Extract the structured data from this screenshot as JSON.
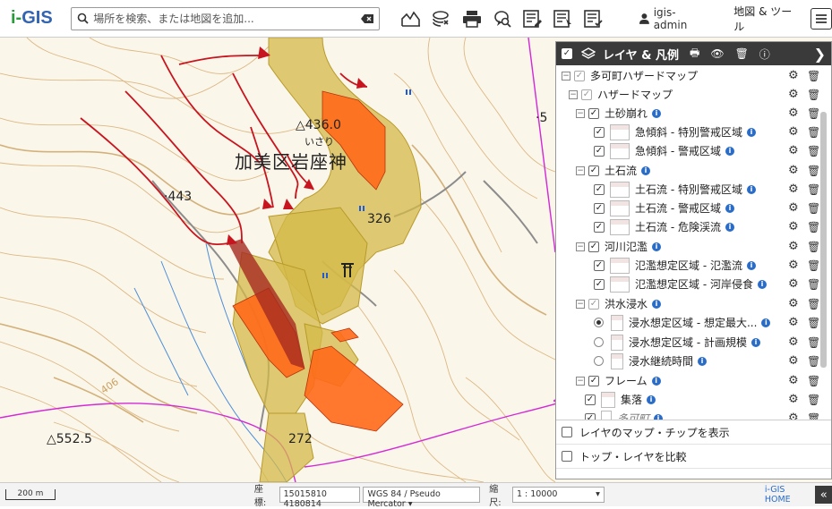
{
  "app": {
    "logo_i": "i-",
    "logo_gis": "GIS",
    "brand_colors": {
      "i": "#2a9a3a",
      "gis": "#3264b0"
    }
  },
  "search": {
    "placeholder": "場所を検索、または地図を追加..."
  },
  "toolbar": {
    "icons": [
      "elevation-profile-icon",
      "layers-stack-icon",
      "print-icon",
      "location-search-icon",
      "list-edit-icon",
      "list-select-icon",
      "list-check-icon"
    ]
  },
  "user": {
    "name": "igis-admin"
  },
  "map_tool_label": "地図 & ツール",
  "map": {
    "labels": {
      "peak_436": "△436.0",
      "isari": "いさり",
      "place": "加美区岩座神",
      "spot_443": "·443",
      "elev_26": "326",
      "peak_552": "△552.5",
      "elev_272": "272",
      "elev_406": "406",
      "edge_5": "·5"
    },
    "colors": {
      "yellow_zone": "#d8c04a",
      "orange_zone": "#ff6a1a",
      "red_line": "#c8141e",
      "magenta_boundary": "#d42ad4",
      "river": "#3a7ad8"
    }
  },
  "panel": {
    "title": "レイヤ & 凡例",
    "rows": [
      {
        "label": "多可町ハザードマップ",
        "type": "group0"
      },
      {
        "label": "ハザードマップ",
        "type": "group1"
      },
      {
        "label": "土砂崩れ",
        "type": "group2"
      },
      {
        "label": "急傾斜 - 特別警戒区域",
        "type": "layer"
      },
      {
        "label": "急傾斜 - 警戒区域",
        "type": "layer"
      },
      {
        "label": "土石流",
        "type": "group2"
      },
      {
        "label": "土石流 - 特別警戒区域",
        "type": "layer"
      },
      {
        "label": "土石流 - 警戒区域",
        "type": "layer"
      },
      {
        "label": "土石流 - 危険渓流",
        "type": "layer"
      },
      {
        "label": "河川氾濫",
        "type": "group2"
      },
      {
        "label": "氾濫想定区域 - 氾濫流",
        "type": "layer"
      },
      {
        "label": "氾濫想定区域 - 河岸侵食",
        "type": "layer"
      },
      {
        "label": "洪水浸水",
        "type": "group2grey"
      },
      {
        "label": "浸水想定区域 - 想定最大...",
        "type": "radio_on"
      },
      {
        "label": "浸水想定区域 - 計画規模",
        "type": "radio"
      },
      {
        "label": "浸水継続時間",
        "type": "radio"
      },
      {
        "label": "フレーム",
        "type": "group2"
      },
      {
        "label": "集落",
        "type": "layer"
      },
      {
        "label": "多可町",
        "type": "layer_italic"
      }
    ],
    "show_chips": "レイヤのマップ・チップを表示",
    "compare_top": "トップ・レイヤを比較"
  },
  "statusbar": {
    "scale_bar": "200 m",
    "coord_label": "座標:",
    "coord_value": "15015810 4180814",
    "crs": "WGS 84 / Pseudo Mercator",
    "scale_label": "縮尺:",
    "scale_value": "1 : 10000",
    "home": "i-GIS HOME"
  }
}
